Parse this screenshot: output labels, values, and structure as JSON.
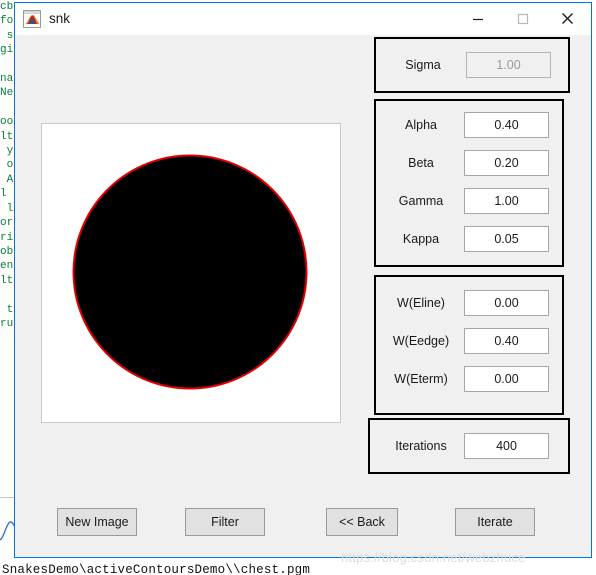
{
  "window": {
    "title": "snk",
    "icon": "matlab-membrane-icon",
    "accent_color": "#0078d7",
    "background_color": "#f0f0f0",
    "controls": {
      "minimize": "—",
      "maximize": "□",
      "close": "✕"
    }
  },
  "canvas": {
    "name": "snake-contour-image",
    "background_color": "#ffffff",
    "shape_color": "#000000",
    "contour_color": "#e00000"
  },
  "panels": {
    "sigma": {
      "fields": [
        {
          "label": "Sigma",
          "value": "1.00",
          "disabled": true
        }
      ]
    },
    "snake": {
      "fields": [
        {
          "label": "Alpha",
          "value": "0.40",
          "disabled": false
        },
        {
          "label": "Beta",
          "value": "0.20",
          "disabled": false
        },
        {
          "label": "Gamma",
          "value": "1.00",
          "disabled": false
        },
        {
          "label": "Kappa",
          "value": "0.05",
          "disabled": false
        }
      ]
    },
    "weights": {
      "fields": [
        {
          "label": "W(Eline)",
          "value": "0.00",
          "disabled": false
        },
        {
          "label": "W(Eedge)",
          "value": "0.40",
          "disabled": false
        },
        {
          "label": "W(Eterm)",
          "value": "0.00",
          "disabled": false
        }
      ]
    },
    "iterations": {
      "fields": [
        {
          "label": "Iterations",
          "value": "400",
          "disabled": false
        }
      ]
    }
  },
  "buttons": {
    "new_image": "New Image",
    "filter": "Filter",
    "back": "<< Back",
    "iterate": "Iterate"
  },
  "background_editor": {
    "status_path": "SnakesDemo\\activeContoursDemo\\\\chest.pgm",
    "code_fragment": "cb\nfo\n s\ngi\n\nna\nNe\n\noo\nlt\n y\n o\n A\nl\n l\nor\nri\nob\nen\nlt\n\n t\nru"
  },
  "watermark": {
    "text": "https://blog.csdn.net/webzhuce"
  }
}
